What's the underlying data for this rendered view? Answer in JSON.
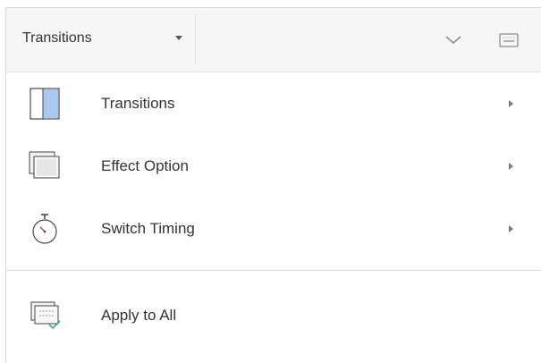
{
  "header": {
    "title": "Transitions",
    "dropdown_icon": "caret-down-icon",
    "collapse_icon": "chevron-down-icon",
    "keyboard_icon": "keyboard-icon"
  },
  "menu": {
    "items": [
      {
        "label": "Transitions",
        "icon": "transition-slide-icon",
        "submenu_icon": "caret-right-icon"
      },
      {
        "label": "Effect Option",
        "icon": "effect-option-icon",
        "submenu_icon": "caret-right-icon"
      },
      {
        "label": "Switch Timing",
        "icon": "stopwatch-icon",
        "submenu_icon": "caret-right-icon"
      }
    ],
    "apply_all": {
      "label": "Apply to All",
      "icon": "apply-to-all-icon"
    }
  },
  "colors": {
    "accent": "#a9c8f0",
    "header_bg": "#f6f6f6",
    "text": "#333333",
    "check": "#3aa6a0"
  }
}
